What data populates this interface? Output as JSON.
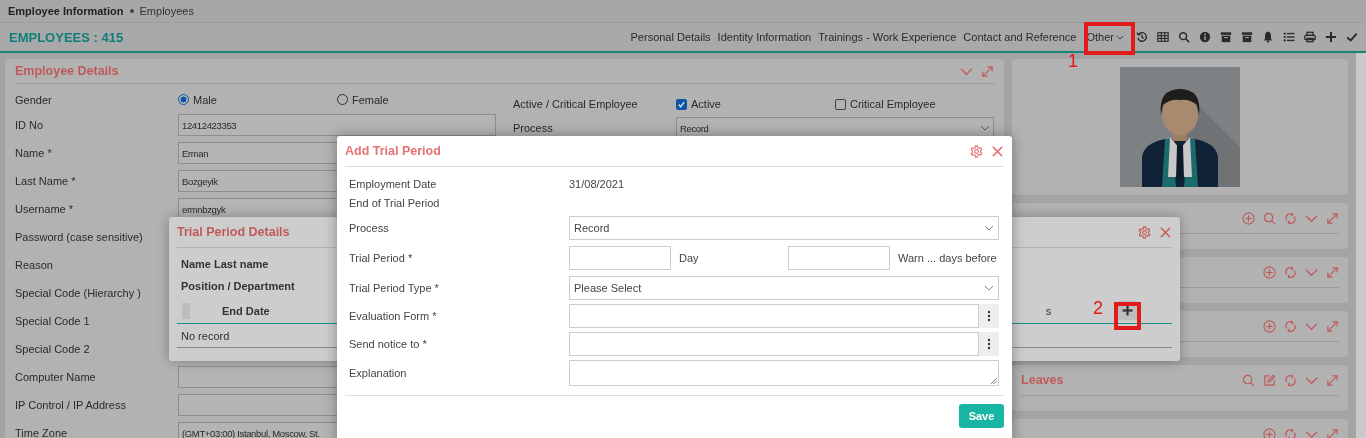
{
  "breadcrumb": {
    "title": "Employee Information",
    "current": "Employees"
  },
  "header": {
    "count": "EMPLOYEES : 415",
    "nav_tabs": [
      {
        "label": "Personal Details",
        "selected": false
      },
      {
        "label": "Identity Information",
        "selected": false
      },
      {
        "label": "Trainings - Work Experience",
        "selected": false
      },
      {
        "label": "Contact and Reference",
        "selected": false
      }
    ],
    "other_menu": "Other"
  },
  "employee_details": {
    "title": "Employee Details",
    "gender": {
      "label": "Gender",
      "options": [
        {
          "label": "Male",
          "selected": true
        },
        {
          "label": "Female",
          "selected": false
        }
      ]
    },
    "fields": [
      {
        "label": "ID No",
        "value": "12412423353"
      },
      {
        "label": "Name *",
        "value": "Erman"
      },
      {
        "label": "Last Name *",
        "value": "Bozgeyik"
      },
      {
        "label": "Username *",
        "value": "ermnbzgyk"
      },
      {
        "label": "Password (case sensitive)"
      },
      {
        "label": "Reason"
      },
      {
        "label": "Special Code (Hierarchy )"
      },
      {
        "label": "Special Code 1"
      },
      {
        "label": "Special Code 2"
      },
      {
        "label": "Computer Name"
      },
      {
        "label": "IP Control / IP Address"
      },
      {
        "label": "Time Zone",
        "value": "(GMT+03:00) Istanbul, Moscow, St."
      }
    ],
    "status": {
      "label": "Active / Critical Employee",
      "options": [
        {
          "label": "Active",
          "checked": true
        },
        {
          "label": "Critical Employee",
          "checked": false
        }
      ]
    },
    "process": {
      "label": "Process",
      "value": "Record"
    }
  },
  "side_cards": [
    {
      "title": "Leaves"
    }
  ],
  "trial_period_details": {
    "title": "Trial Period Details",
    "info": [
      "Name Last name",
      "Position / Department"
    ],
    "table": {
      "columns": [
        "End Date",
        "s"
      ],
      "empty": "No record"
    }
  },
  "add_trial_period": {
    "title": "Add Trial Period",
    "fields": [
      {
        "kind": "static",
        "label": "Employment Date",
        "value": "31/08/2021"
      },
      {
        "kind": "static",
        "label": "End of Trial Period"
      },
      {
        "kind": "select",
        "label": "Process",
        "value": "Record"
      },
      {
        "kind": "period",
        "label": "Trial Period *",
        "unit": "Day",
        "warn": "Warn ... days before"
      },
      {
        "kind": "select",
        "label": "Trial Period Type *",
        "value": "Please Select"
      },
      {
        "kind": "lookup",
        "label": "Evaluation Form *"
      },
      {
        "kind": "lookup",
        "label": "Send notice to *"
      },
      {
        "kind": "textarea",
        "label": "Explanation"
      }
    ],
    "save": "Save"
  },
  "annotations": [
    {
      "number": "1"
    },
    {
      "number": "2"
    }
  ]
}
